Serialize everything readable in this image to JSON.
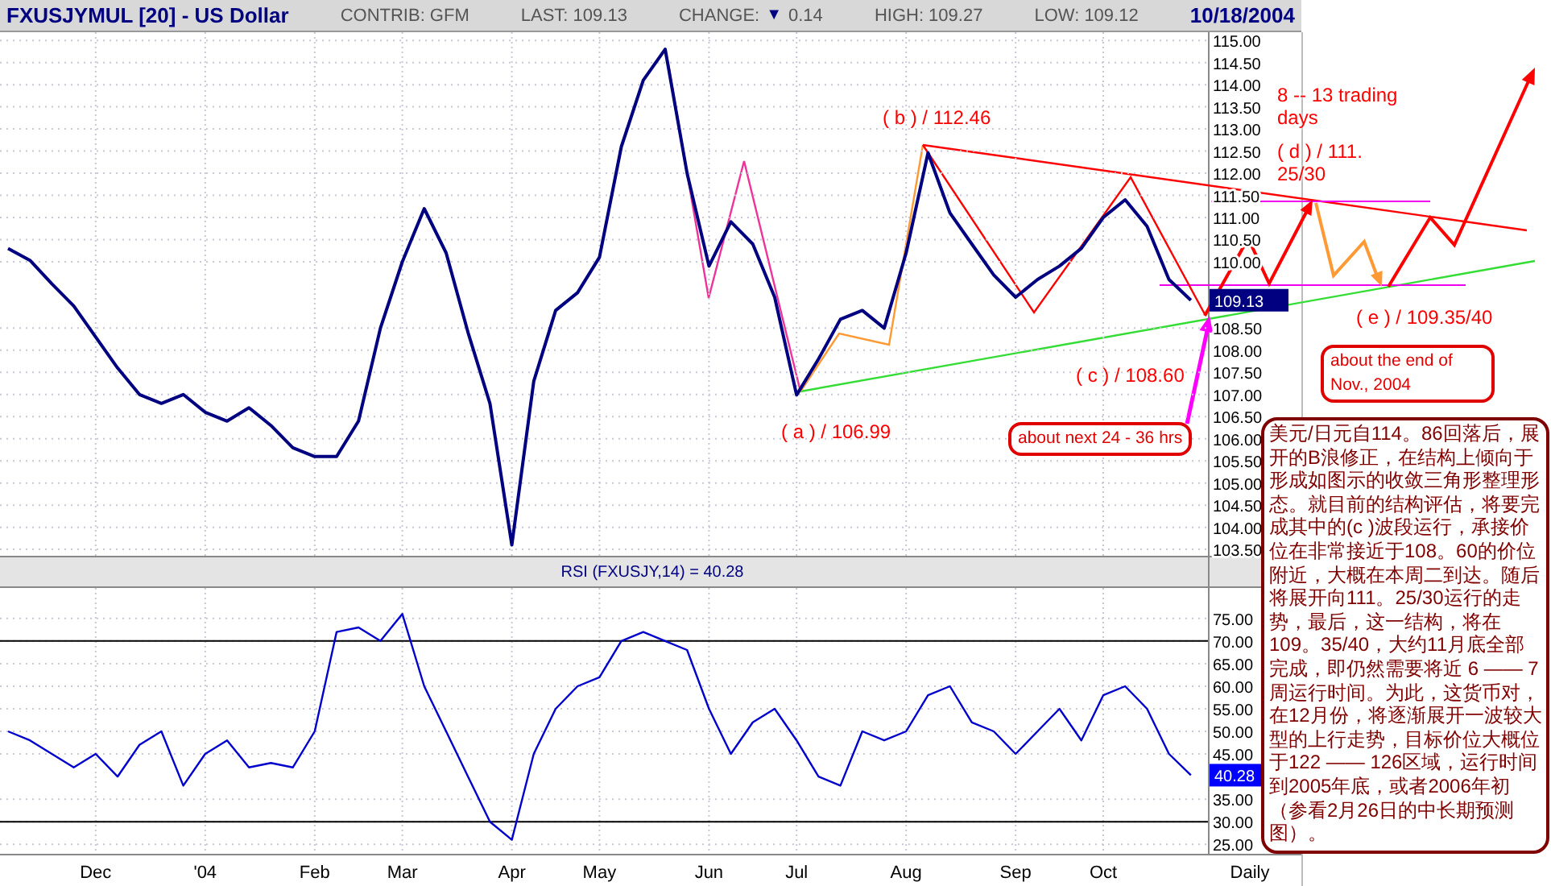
{
  "header": {
    "title": "FXUSJYMUL [20] - US Dollar",
    "date": "10/18/2004",
    "fields": [
      {
        "kind": "plain",
        "text": "CONTRIB: GFM"
      },
      {
        "kind": "plain",
        "text": "LAST: 109.13"
      },
      {
        "kind": "change",
        "text": "CHANGE:",
        "arrow": "▼",
        "value": "0.14"
      },
      {
        "kind": "plain",
        "text": "HIGH: 109.27"
      },
      {
        "kind": "plain",
        "text": "LOW: 109.12"
      }
    ]
  },
  "price_panel": {
    "last_tag": "109.13",
    "chart_data": {
      "type": "line",
      "grid": true,
      "ylim": [
        103.32,
        115.04
      ],
      "categories": [
        null,
        null,
        null,
        null,
        null,
        null,
        null,
        null,
        null,
        null,
        null,
        null,
        null,
        null,
        null,
        null,
        null,
        null,
        null,
        null,
        null,
        null,
        null,
        null,
        null,
        null,
        null,
        null,
        null,
        null,
        null,
        null,
        null,
        null,
        null,
        null,
        null,
        null,
        null,
        null,
        null,
        null,
        null,
        null,
        null,
        null,
        null,
        null,
        null,
        null,
        null,
        null,
        null,
        null,
        null
      ],
      "series": [
        {
          "color": "#000080",
          "values": [
            110.3,
            110.03,
            109.5,
            109.0,
            108.3,
            107.6,
            107.0,
            106.8,
            107.0,
            106.6,
            106.4,
            106.7,
            106.3,
            105.8,
            105.6,
            105.6,
            106.4,
            108.5,
            110.0,
            111.2,
            110.2,
            108.4,
            106.8,
            103.6,
            107.3,
            108.9,
            109.3,
            110.1,
            112.6,
            114.1,
            114.8,
            112.0,
            109.9,
            110.9,
            110.4,
            109.2,
            106.99,
            107.8,
            108.7,
            108.9,
            108.5,
            110.2,
            112.46,
            111.1,
            110.4,
            109.7,
            109.2,
            109.6,
            109.9,
            110.3,
            111.0,
            111.4,
            110.8,
            109.6,
            109.13
          ]
        }
      ],
      "yticks": [
        {
          "value": 115,
          "label": "115.00"
        },
        {
          "value": 114.5,
          "label": "114.50"
        },
        {
          "value": 114,
          "label": "114.00"
        },
        {
          "value": 113.5,
          "label": "113.50"
        },
        {
          "value": 113,
          "label": "113.00"
        },
        {
          "value": 112.5,
          "label": "112.50"
        },
        {
          "value": 112,
          "label": "112.00"
        },
        {
          "value": 111.5,
          "label": "111.50"
        },
        {
          "value": 111,
          "label": "111.00"
        },
        {
          "value": 110.5,
          "label": "110.50"
        },
        {
          "value": 110,
          "label": "110.00"
        },
        {
          "value": 108.5,
          "label": "108.50"
        },
        {
          "value": 108,
          "label": "108.00"
        },
        {
          "value": 107.5,
          "label": "107.50"
        },
        {
          "value": 107,
          "label": "107.00"
        },
        {
          "value": 106.5,
          "label": "106.50"
        },
        {
          "value": 106,
          "label": "106.00"
        },
        {
          "value": 105.5,
          "label": "105.50"
        },
        {
          "value": 105,
          "label": "105.00"
        },
        {
          "value": 104.5,
          "label": "104.50"
        },
        {
          "value": 104,
          "label": "104.00"
        },
        {
          "value": 103.5,
          "label": "103.50"
        }
      ]
    },
    "labels": [
      "( b ) / 112.46",
      "( a ) / 106.99",
      "( c ) / 108.60",
      "8 -- 13 trading days",
      "( d ) / 111. 25/30",
      "( e ) / 109.35/40"
    ],
    "callouts": [
      "about next 24 - 36 hrs",
      "about the end of Nov., 2004"
    ]
  },
  "rsi_panel": {
    "title": "RSI (FXUSJY,14) = 40.28",
    "last_tag": "40.28",
    "period": "Daily",
    "chart_data": {
      "type": "line",
      "grid": true,
      "ylim": [
        22.9,
        82.1
      ],
      "categories": [
        null,
        null,
        null,
        null,
        "Dec",
        null,
        null,
        null,
        null,
        "'04",
        null,
        null,
        null,
        null,
        "Feb",
        null,
        null,
        null,
        "Mar",
        null,
        null,
        null,
        null,
        "Apr",
        null,
        null,
        null,
        "May",
        null,
        null,
        null,
        null,
        "Jun",
        null,
        null,
        null,
        "Jul",
        null,
        null,
        null,
        null,
        "Aug",
        null,
        null,
        null,
        null,
        "Sep",
        null,
        null,
        null,
        "Oct",
        null,
        null,
        null,
        null
      ],
      "series": [
        {
          "color": "#0000cc",
          "values": [
            50,
            48,
            45,
            42,
            45,
            40,
            47,
            50,
            38,
            45,
            48,
            42,
            43,
            42,
            50,
            72,
            73,
            70,
            76,
            60,
            50,
            40,
            30,
            26,
            45,
            55,
            60,
            62,
            70,
            72,
            70,
            68,
            55,
            45,
            52,
            55,
            48,
            40,
            38,
            50,
            48,
            50,
            58,
            60,
            52,
            50,
            45,
            50,
            55,
            48,
            58,
            60,
            55,
            45,
            40.3
          ]
        }
      ],
      "yticks": [
        {
          "value": 75,
          "label": "75.00"
        },
        {
          "value": 70,
          "label": "70.00"
        },
        {
          "value": 65,
          "label": "65.00"
        },
        {
          "value": 60,
          "label": "60.00"
        },
        {
          "value": 55,
          "label": "55.00"
        },
        {
          "value": 50,
          "label": "50.00"
        },
        {
          "value": 45,
          "label": "45.00"
        },
        {
          "value": 35,
          "label": "35.00"
        },
        {
          "value": 30,
          "label": "30.00"
        },
        {
          "value": 25,
          "label": "25.00"
        }
      ]
    }
  },
  "commentary": {
    "text": "美元/日元自114。86回落后，展开的B浪修正，在结构上倾向于形成如图示的收敛三角形整理形态。就目前的结构评估，将要完成其中的(c )波段运行，承接价位在非常接近于108。60的价位附近，大概在本周二到达。随后将展开向111。25/30运行的走势，最后，这一结构，将在109。35/40，大约11月底全部完成，即仍然需要将近 6 —— 7 周运行时间。为此，这货币对，在12月份，将逐渐展开一波较大型的上行走势，目标价位大概位于122 —— 126区域，运行时间到2005年底，或者2006年初（参看2月26日的中长期预测图）。"
  }
}
